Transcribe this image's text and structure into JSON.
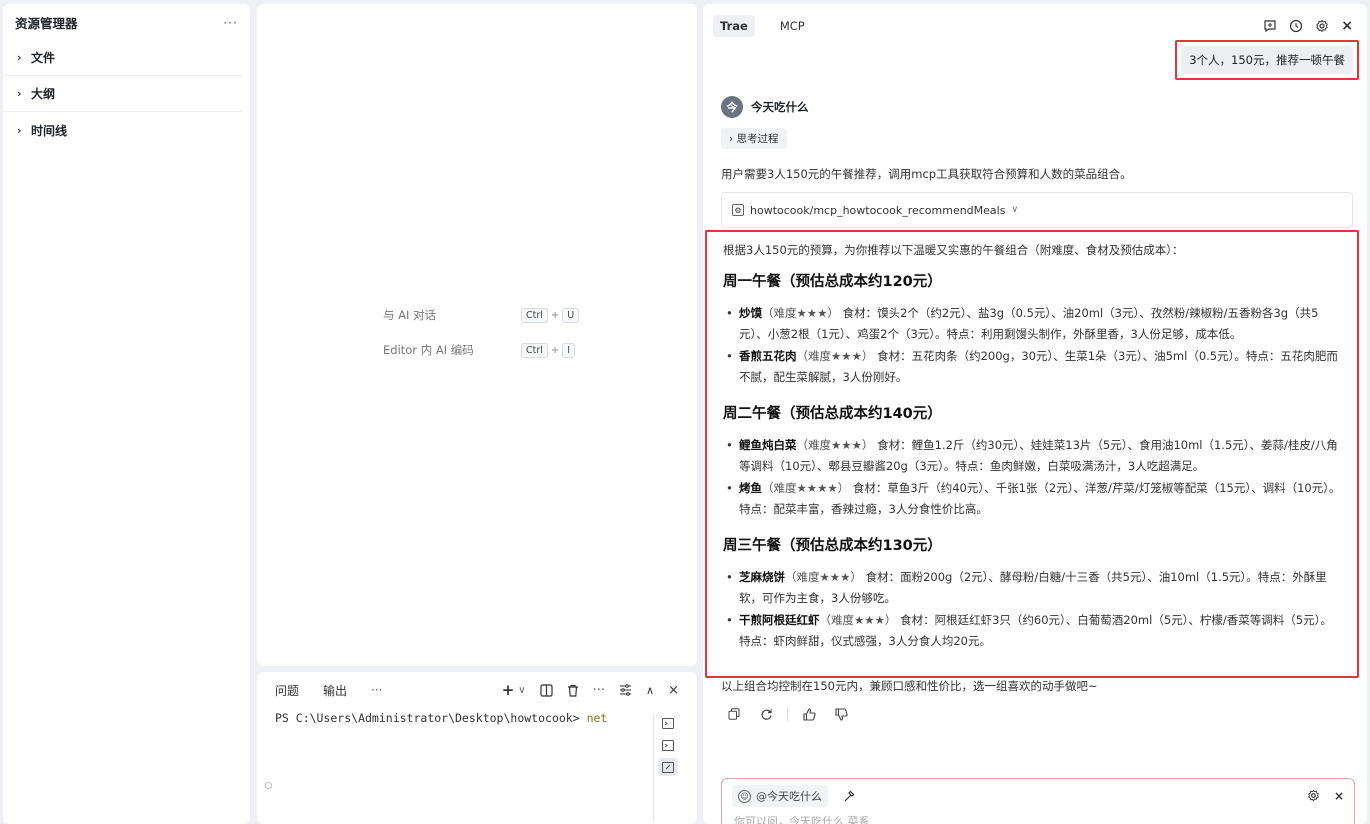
{
  "sidebar": {
    "title": "资源管理器",
    "more": "···",
    "items": [
      {
        "label": "文件"
      },
      {
        "label": "大纲"
      },
      {
        "label": "时间线"
      }
    ]
  },
  "editor": {
    "shortcuts": [
      {
        "label": "与 AI 对话",
        "key1": "Ctrl",
        "key2": "U"
      },
      {
        "label": "Editor 内 AI 编码",
        "key1": "Ctrl",
        "key2": "I"
      }
    ]
  },
  "terminal": {
    "tabs": [
      "问题",
      "输出"
    ],
    "more": "···",
    "prompt": "PS C:\\Users\\Administrator\\Desktop\\howtocook> ",
    "command": "net"
  },
  "chat": {
    "tabs": [
      "Trae",
      "MCP"
    ],
    "user_message": "3个人，150元，推荐一顿午餐",
    "agent_name": "今天吃什么",
    "agent_avatar": "今",
    "thinking_label": "思考过程",
    "intro": "用户需要3人150元的午餐推荐，调用mcp工具获取符合预算和人数的菜品组合。",
    "tool_call": "howtocook/mcp_howtocook_recommendMeals",
    "lead": "根据3人150元的预算，为你推荐以下温暖又实惠的午餐组合（附难度、食材及预估成本）：",
    "meals": [
      {
        "title": "周一午餐（预估总成本约120元）",
        "dishes": [
          {
            "name": "炒馍",
            "difficulty": "（难度★★★）",
            "detail": "食材：馍头2个（约2元）、盐3g（0.5元）、油20ml（3元）、孜然粉/辣椒粉/五香粉各3g（共5元）、小葱2根（1元）、鸡蛋2个（3元）。特点：利用剩馒头制作，外酥里香，3人份足够，成本低。"
          },
          {
            "name": "香煎五花肉",
            "difficulty": "（难度★★★）",
            "detail": "食材：五花肉条（约200g，30元）、生菜1朵（3元）、油5ml（0.5元）。特点：五花肉肥而不腻，配生菜解腻，3人份刚好。"
          }
        ]
      },
      {
        "title": "周二午餐（预估总成本约140元）",
        "dishes": [
          {
            "name": "鲤鱼炖白菜",
            "difficulty": "（难度★★★）",
            "detail": "食材：鲤鱼1.2斤（约30元）、娃娃菜13片（5元）、食用油10ml（1.5元）、姜蒜/桂皮/八角等调料（10元）、郫县豆瓣酱20g（3元）。特点：鱼肉鲜嫩，白菜吸满汤汁，3人吃超满足。"
          },
          {
            "name": "烤鱼",
            "difficulty": "（难度★★★★）",
            "detail": "食材：草鱼3斤（约40元）、千张1张（2元）、洋葱/芹菜/灯笼椒等配菜（15元）、调料（10元）。特点：配菜丰富，香辣过瘾，3人分食性价比高。"
          }
        ]
      },
      {
        "title": "周三午餐（预估总成本约130元）",
        "dishes": [
          {
            "name": "芝麻烧饼",
            "difficulty": "（难度★★★）",
            "detail": "食材：面粉200g（2元）、酵母粉/白糖/十三香（共5元）、油10ml（1.5元）。特点：外酥里软，可作为主食，3人份够吃。"
          },
          {
            "name": "干煎阿根廷红虾",
            "difficulty": "（难度★★★）",
            "detail": "食材：阿根廷红虾3只（约60元）、白葡萄酒20ml（5元）、柠檬/香菜等调料（5元）。特点：虾肉鲜甜，仪式感强，3人分食人均20元。"
          }
        ]
      }
    ],
    "footer": "以上组合均控制在150元内，兼顾口感和性价比，选一组喜欢的动手做吧~",
    "input": {
      "mention": "@今天吃什么",
      "placeholder": "你可以问，今天吃什么 菜系"
    }
  },
  "colors": {
    "highlight": "#e0353b",
    "panel_bg": "#ffffff",
    "app_bg": "#eef0f3"
  }
}
